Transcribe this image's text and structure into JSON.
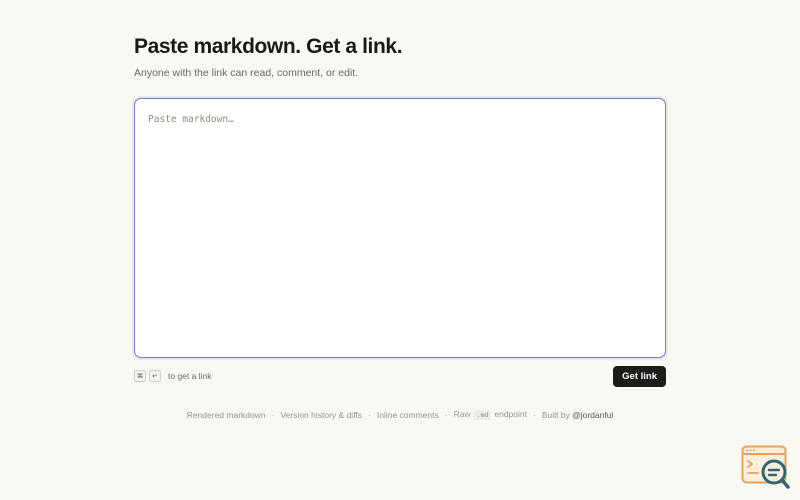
{
  "header": {
    "title": "Paste markdown. Get a link.",
    "subtitle": "Anyone with the link can read, comment, or edit."
  },
  "editor": {
    "value": "",
    "placeholder": "Paste markdown…"
  },
  "shortcut": {
    "key1": "⌘",
    "key2": "↵",
    "hint": "to get a link"
  },
  "actions": {
    "get_link_label": "Get link"
  },
  "footer": {
    "items": {
      "rendered": "Rendered markdown",
      "history": "Version history & diffs",
      "comments": "Inline comments",
      "raw_prefix": "Raw",
      "raw_code": ".md",
      "raw_suffix": "endpoint",
      "built_prefix": "Built by",
      "built_handle": "@jordanful"
    },
    "separator": "·"
  },
  "icons": {
    "corner": "browser-search-icon"
  },
  "colors": {
    "background": "#faf8f3",
    "accent": "#6f82c9",
    "button": "#1c1b18",
    "logo_orange": "#e8a15b",
    "logo_teal": "#2f6673"
  }
}
